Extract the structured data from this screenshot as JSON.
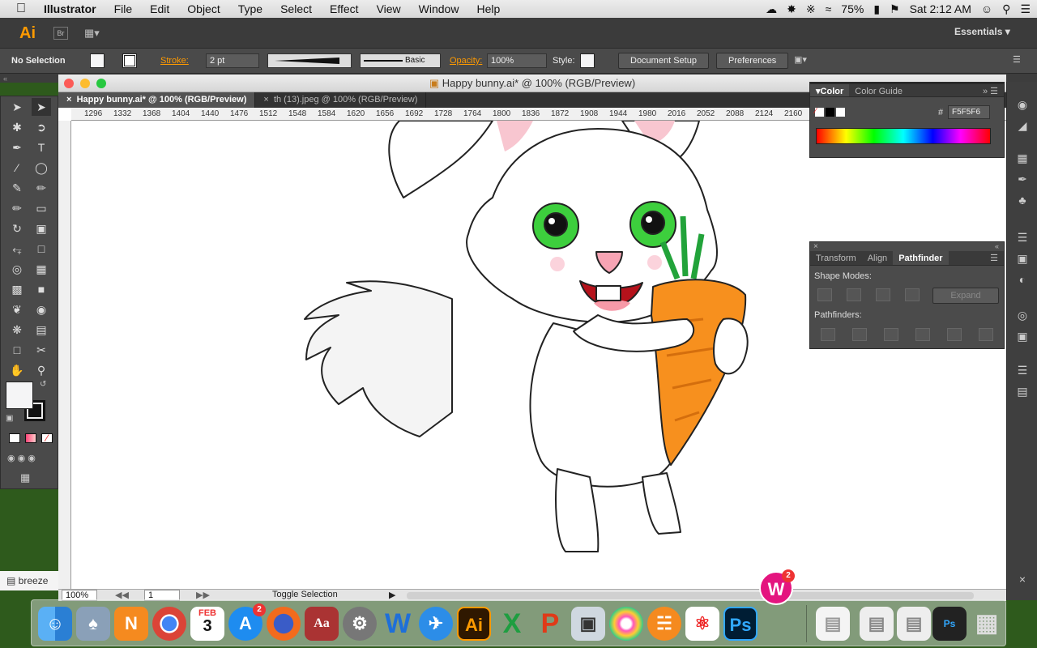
{
  "menubar": {
    "app": "Illustrator",
    "items": [
      "File",
      "Edit",
      "Object",
      "Type",
      "Select",
      "Effect",
      "View",
      "Window",
      "Help"
    ],
    "battery": "75%",
    "clock": "Sat 2:12 AM"
  },
  "appbar": {
    "logo": "Ai",
    "bridge": "Br",
    "workspace": "Essentials"
  },
  "control": {
    "selection": "No Selection",
    "stroke_label": "Stroke:",
    "stroke_value": "2 pt",
    "brush": "Basic",
    "opacity_label": "Opacity:",
    "opacity_value": "100%",
    "style_label": "Style:",
    "doc_setup": "Document Setup",
    "preferences": "Preferences"
  },
  "window": {
    "title": "Happy bunny.ai* @ 100% (RGB/Preview)"
  },
  "tabs": [
    {
      "label": "Happy bunny.ai* @ 100% (RGB/Preview)"
    },
    {
      "label": "th (13).jpeg @ 100% (RGB/Preview)"
    }
  ],
  "ruler": [
    "1296",
    "1332",
    "1368",
    "1404",
    "1440",
    "1476",
    "1512",
    "1548",
    "1584",
    "1620",
    "1656",
    "1692",
    "1728",
    "1764",
    "1800",
    "1836",
    "1872",
    "1908",
    "1944",
    "1980",
    "2016",
    "2052",
    "2088",
    "2124",
    "2160"
  ],
  "color_panel": {
    "tabs": [
      "Color",
      "Color Guide"
    ],
    "hex": "F5F5F6"
  },
  "pathfinder_panel": {
    "tabs": [
      "Transform",
      "Align",
      "Pathfinder"
    ],
    "shape_modes": "Shape Modes:",
    "expand": "Expand",
    "pathfinders": "Pathfinders:"
  },
  "statusbar": {
    "zoom": "100%",
    "artboard": "1",
    "toggle": "Toggle Selection"
  },
  "sidebar_file": "breeze",
  "colors": {
    "carrot": "#f7901e",
    "leaf": "#22a33a",
    "eye": "#3dcf3d",
    "pink": "#f7a4b4",
    "accent": "#ff9a00"
  },
  "dock": {
    "apps": [
      "Finder",
      "Preview",
      "Notability",
      "Chrome",
      "Calendar",
      "App Store",
      "Firefox",
      "Dictionary",
      "System Preferences",
      "Word",
      "Mail",
      "Illustrator",
      "Excel",
      "PowerPoint",
      "Image Capture",
      "Photos",
      "iBooks",
      "Acrobat",
      "Photoshop"
    ],
    "calendar_month": "FEB",
    "calendar_day": "3",
    "badge_appstore": "2",
    "badge_w": "2"
  }
}
